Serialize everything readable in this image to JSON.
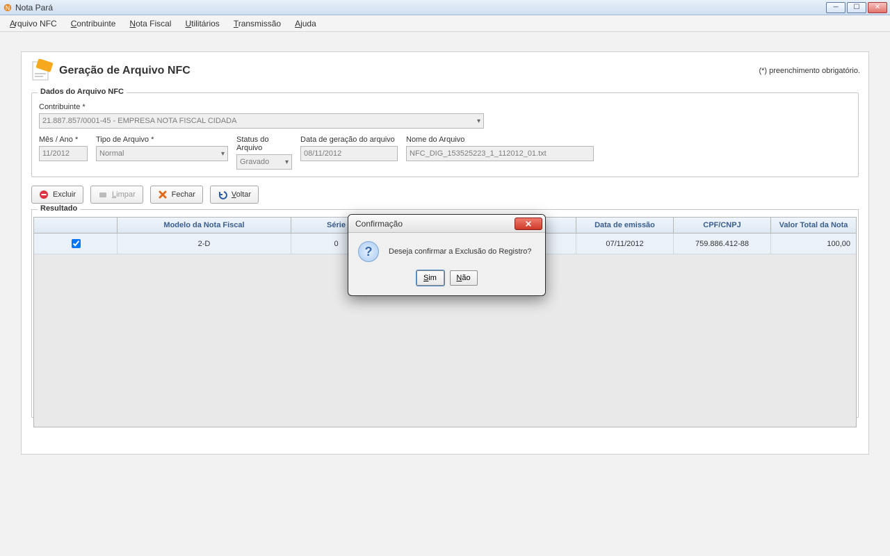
{
  "title": "Nota Pará",
  "menu": {
    "arquivo": "Arquivo NFC",
    "contribuinte": "Contribuinte",
    "nota": "Nota Fiscal",
    "utilitarios": "Utilitários",
    "transmissao": "Transmissão",
    "ajuda": "Ajuda"
  },
  "page": {
    "title": "Geração de Arquivo NFC",
    "required_note": "(*) preenchimento obrigatório."
  },
  "form": {
    "group_title": "Dados do Arquivo NFC",
    "contribuinte_label": "Contribuinte *",
    "contribuinte_value": "21.887.857/0001-45 - EMPRESA NOTA FISCAL CIDADA",
    "mesano_label": "Mês / Ano *",
    "mesano_value": "11/2012",
    "tipo_label": "Tipo de Arquivo *",
    "tipo_value": "Normal",
    "status_label": "Status do Arquivo",
    "status_value": "Gravado",
    "data_label": "Data de geração do arquivo",
    "data_value": "08/11/2012",
    "nome_label": "Nome do Arquivo",
    "nome_value": "NFC_DIG_153525223_1_112012_01.txt"
  },
  "buttons": {
    "excluir": "Excluir",
    "limpar": "Limpar",
    "fechar": "Fechar",
    "voltar": "Voltar"
  },
  "result": {
    "legend": "Resultado",
    "headers": {
      "check": "",
      "modelo": "Modelo da Nota Fiscal",
      "serie": "Série",
      "mid": "",
      "data": "Data de emissão",
      "cpf": "CPF/CNPJ",
      "valor": "Valor Total da Nota"
    },
    "row": {
      "modelo": "2-D",
      "serie": "0",
      "data": "07/11/2012",
      "cpf": "759.886.412-88",
      "valor": "100,00"
    }
  },
  "dialog": {
    "title": "Confirmação",
    "message": "Deseja confirmar a Exclusão do Registro?",
    "sim": "Sim",
    "nao": "Não"
  }
}
